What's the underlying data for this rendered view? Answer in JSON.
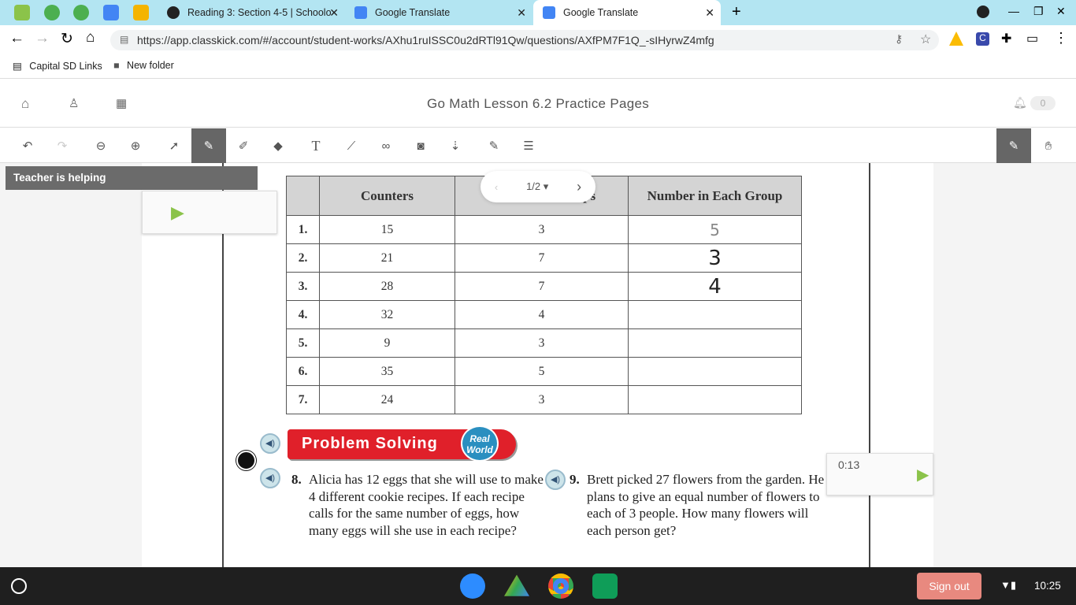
{
  "browser": {
    "tabs": [
      {
        "label": "Reading 3: Section 4-5 | Schoolo"
      },
      {
        "label": "Google Translate"
      },
      {
        "label": "Google Translate"
      }
    ],
    "url": "https://app.classkick.com/#/account/student-works/AXhu1ruISSC0u2dRTl91Qw/questions/AXfPM7F1Q_-sIHyrwZ4mfg",
    "bookmarks": [
      "Capital SD Links",
      "New folder"
    ]
  },
  "app": {
    "title": "Go Math Lesson 6.2 Practice Pages",
    "notifications": "0",
    "helping": "Teacher is helping",
    "pager": "1/2",
    "timer": "0:13"
  },
  "table": {
    "headers": [
      "Counters",
      "Number of Groups",
      "Number in Each Group"
    ],
    "rows": [
      {
        "n": "1.",
        "counters": "15",
        "groups": "3",
        "answer": "5"
      },
      {
        "n": "2.",
        "counters": "21",
        "groups": "7",
        "answer": "3"
      },
      {
        "n": "3.",
        "counters": "28",
        "groups": "7",
        "answer": "4"
      },
      {
        "n": "4.",
        "counters": "32",
        "groups": "4",
        "answer": ""
      },
      {
        "n": "5.",
        "counters": "9",
        "groups": "3",
        "answer": ""
      },
      {
        "n": "6.",
        "counters": "35",
        "groups": "5",
        "answer": ""
      },
      {
        "n": "7.",
        "counters": "24",
        "groups": "3",
        "answer": ""
      }
    ]
  },
  "problem_solving": {
    "banner": "Problem Solving",
    "badge": "Real World",
    "q8": {
      "n": "8.",
      "text": "Alicia has 12 eggs that she will use to make 4 different cookie recipes. If each recipe calls for the same number of eggs, how many eggs will she use in each recipe?"
    },
    "q9": {
      "n": "9.",
      "text": "Brett picked 27 flowers from the garden. He plans to give an equal number of flowers to each of 3 people. How many flowers will each person get?"
    }
  },
  "taskbar": {
    "signout": "Sign out",
    "time": "10:25"
  }
}
